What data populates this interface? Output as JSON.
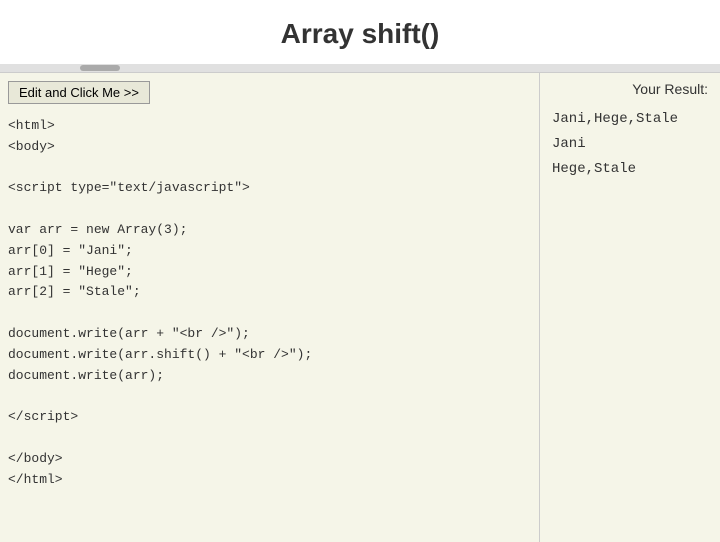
{
  "header": {
    "title": "Array shift()"
  },
  "button": {
    "label": "Edit and Click Me >>"
  },
  "code": {
    "content": "<html>\n<body>\n\n<script type=\"text/javascript\">\n\nvar arr = new Array(3);\narr[0] = \"Jani\";\narr[1] = \"Hege\";\narr[2] = \"Stale\";\n\ndocument.write(arr + \"<br />\");\ndocument.write(arr.shift() + \"<br />\");\ndocument.write(arr);\n\n</script>\n\n</body>\n</html>"
  },
  "result": {
    "label": "Your Result:",
    "lines": [
      "Jani,Hege,Stale",
      "Jani",
      "Hege,Stale"
    ]
  }
}
